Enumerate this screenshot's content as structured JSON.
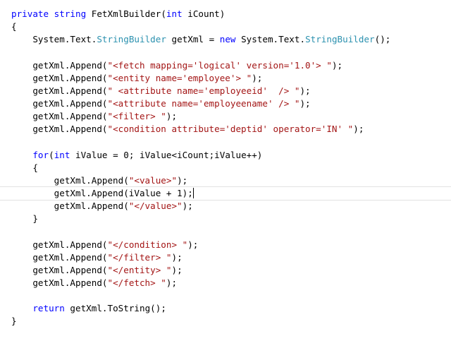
{
  "editor": {
    "lines": [
      [
        {
          "t": "private",
          "c": "kw"
        },
        {
          "t": " ",
          "c": "tx"
        },
        {
          "t": "string",
          "c": "kw"
        },
        {
          "t": " FetXmlBuilder(",
          "c": "tx"
        },
        {
          "t": "int",
          "c": "kw"
        },
        {
          "t": " iCount)",
          "c": "tx"
        }
      ],
      [
        {
          "t": "{",
          "c": "tx"
        }
      ],
      [
        {
          "t": "    System.Text.",
          "c": "tx"
        },
        {
          "t": "StringBuilder",
          "c": "ty"
        },
        {
          "t": " getXml = ",
          "c": "tx"
        },
        {
          "t": "new",
          "c": "kw"
        },
        {
          "t": " System.Text.",
          "c": "tx"
        },
        {
          "t": "StringBuilder",
          "c": "ty"
        },
        {
          "t": "();",
          "c": "tx"
        }
      ],
      [],
      [
        {
          "t": "    getXml.Append(",
          "c": "tx"
        },
        {
          "t": "\"<fetch mapping='logical' version='1.0'> \"",
          "c": "st"
        },
        {
          "t": ");",
          "c": "tx"
        }
      ],
      [
        {
          "t": "    getXml.Append(",
          "c": "tx"
        },
        {
          "t": "\"<entity name='employee'> \"",
          "c": "st"
        },
        {
          "t": ");",
          "c": "tx"
        }
      ],
      [
        {
          "t": "    getXml.Append(",
          "c": "tx"
        },
        {
          "t": "\" <attribute name='employeeid'  /> \"",
          "c": "st"
        },
        {
          "t": ");",
          "c": "tx"
        }
      ],
      [
        {
          "t": "    getXml.Append(",
          "c": "tx"
        },
        {
          "t": "\"<attribute name='employeename' /> \"",
          "c": "st"
        },
        {
          "t": ");",
          "c": "tx"
        }
      ],
      [
        {
          "t": "    getXml.Append(",
          "c": "tx"
        },
        {
          "t": "\"<filter> \"",
          "c": "st"
        },
        {
          "t": ");",
          "c": "tx"
        }
      ],
      [
        {
          "t": "    getXml.Append(",
          "c": "tx"
        },
        {
          "t": "\"<condition attribute='deptid' operator='IN' \"",
          "c": "st"
        },
        {
          "t": ");",
          "c": "tx"
        }
      ],
      [],
      [
        {
          "t": "    ",
          "c": "tx"
        },
        {
          "t": "for",
          "c": "kw"
        },
        {
          "t": "(",
          "c": "tx"
        },
        {
          "t": "int",
          "c": "kw"
        },
        {
          "t": " iValue = 0; iValue<iCount;iValue++)",
          "c": "tx"
        }
      ],
      [
        {
          "t": "    {",
          "c": "tx"
        }
      ],
      [
        {
          "t": "        getXml.Append(",
          "c": "tx"
        },
        {
          "t": "\"<value>\"",
          "c": "st"
        },
        {
          "t": ");",
          "c": "tx"
        }
      ],
      [
        {
          "t": "        getXml.Append(iValue + 1);",
          "c": "tx"
        },
        {
          "t": "",
          "c": "caret"
        }
      ],
      [
        {
          "t": "        getXml.Append(",
          "c": "tx"
        },
        {
          "t": "\"</value>\"",
          "c": "st"
        },
        {
          "t": ");",
          "c": "tx"
        }
      ],
      [
        {
          "t": "    }",
          "c": "tx"
        }
      ],
      [],
      [
        {
          "t": "    getXml.Append(",
          "c": "tx"
        },
        {
          "t": "\"</condition> \"",
          "c": "st"
        },
        {
          "t": ");",
          "c": "tx"
        }
      ],
      [
        {
          "t": "    getXml.Append(",
          "c": "tx"
        },
        {
          "t": "\"</filter> \"",
          "c": "st"
        },
        {
          "t": ");",
          "c": "tx"
        }
      ],
      [
        {
          "t": "    getXml.Append(",
          "c": "tx"
        },
        {
          "t": "\"</entity> \"",
          "c": "st"
        },
        {
          "t": ");",
          "c": "tx"
        }
      ],
      [
        {
          "t": "    getXml.Append(",
          "c": "tx"
        },
        {
          "t": "\"</fetch> \"",
          "c": "st"
        },
        {
          "t": ");",
          "c": "tx"
        }
      ],
      [],
      [
        {
          "t": "    ",
          "c": "tx"
        },
        {
          "t": "return",
          "c": "kw"
        },
        {
          "t": " getXml.ToString();",
          "c": "tx"
        }
      ],
      [
        {
          "t": "}",
          "c": "tx"
        }
      ]
    ],
    "current_line": 14,
    "colors": {
      "keyword": "#0000ff",
      "type": "#2b91af",
      "string": "#a31515",
      "text": "#000000",
      "current_line_border": "#e2e2e2"
    }
  }
}
